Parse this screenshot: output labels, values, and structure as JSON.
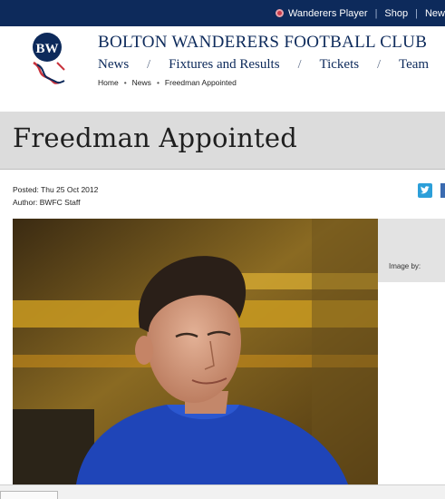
{
  "topbar": {
    "links": [
      {
        "label": "Wanderers Player",
        "icon": "radio-icon"
      },
      {
        "label": "Shop"
      },
      {
        "label": "New"
      }
    ]
  },
  "header": {
    "club_name": "BOLTON WANDERERS FOOTBALL CLUB",
    "crest_text": "BW",
    "nav": [
      "News",
      "Fixtures and Results",
      "Tickets",
      "Team"
    ],
    "breadcrumb": [
      "Home",
      "News",
      "Freedman Appointed"
    ]
  },
  "article": {
    "title": "Freedman Appointed",
    "posted": "Posted: Thu 25 Oct 2012",
    "author": "Author: BWFC Staff",
    "image_by": "Image by:"
  },
  "colors": {
    "navy": "#0d2a5b",
    "title_band": "#dcdcdc",
    "twitter": "#2c9fd9",
    "facebook": "#3b6bb0"
  }
}
